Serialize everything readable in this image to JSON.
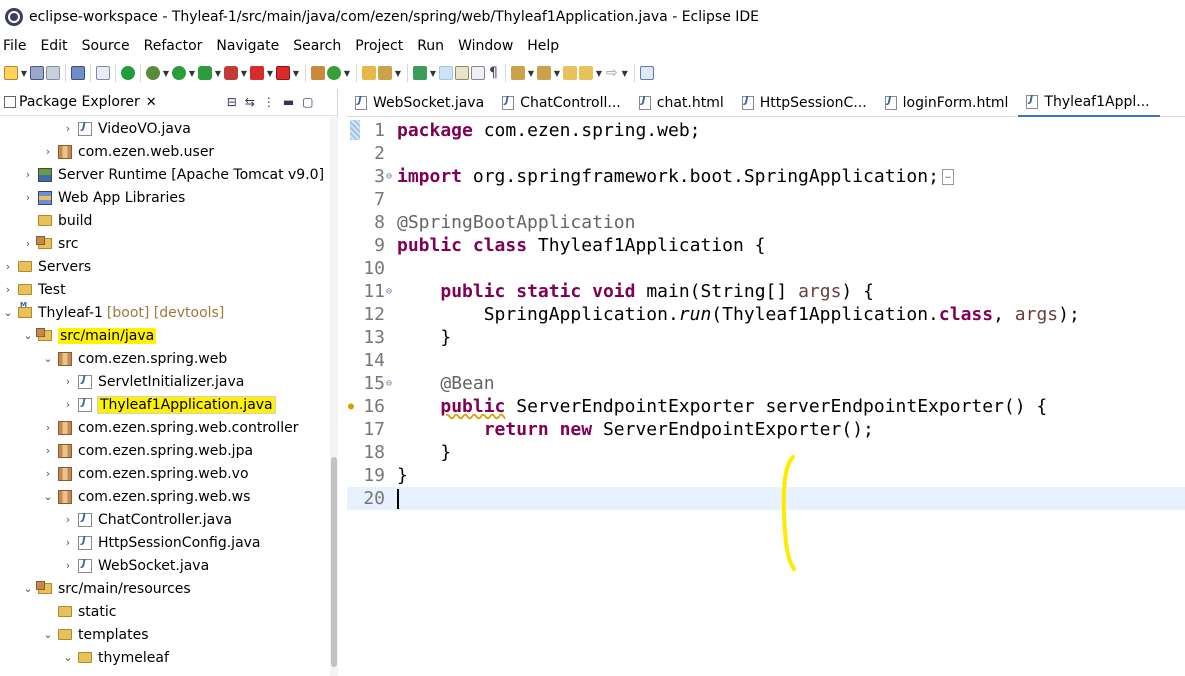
{
  "window": {
    "title": "eclipse-workspace - Thyleaf-1/src/main/java/com/ezen/spring/web/Thyleaf1Application.java - Eclipse IDE"
  },
  "menu": [
    "File",
    "Edit",
    "Source",
    "Refactor",
    "Navigate",
    "Search",
    "Project",
    "Run",
    "Window",
    "Help"
  ],
  "package_explorer": {
    "title": "Package Explorer",
    "close_glyph": "✕",
    "rows": [
      {
        "indent": 3,
        "twisty": "›",
        "icon": "java",
        "label": "VideoVO.java"
      },
      {
        "indent": 2,
        "twisty": "›",
        "icon": "pkg",
        "label": "com.ezen.web.user"
      },
      {
        "indent": 1,
        "twisty": "›",
        "icon": "server",
        "label": "Server Runtime [Apache Tomcat v9.0]"
      },
      {
        "indent": 1,
        "twisty": "›",
        "icon": "lib",
        "label": "Web App Libraries"
      },
      {
        "indent": 1,
        "twisty": "",
        "icon": "folder",
        "label": "build"
      },
      {
        "indent": 1,
        "twisty": "›",
        "icon": "srcfolder",
        "label": "src"
      },
      {
        "indent": 0,
        "twisty": "›",
        "icon": "folder",
        "label": "Servers"
      },
      {
        "indent": 0,
        "twisty": "›",
        "icon": "folder",
        "label": "Test"
      },
      {
        "indent": 0,
        "twisty": "⌄",
        "icon": "project",
        "label": "Thyleaf-1",
        "decoration": "[boot] [devtools]"
      },
      {
        "indent": 1,
        "twisty": "⌄",
        "icon": "srcfolder",
        "label": "src/main/java",
        "highlight": true
      },
      {
        "indent": 2,
        "twisty": "⌄",
        "icon": "pkg",
        "label": "com.ezen.spring.web"
      },
      {
        "indent": 3,
        "twisty": "›",
        "icon": "java",
        "label": "ServletInitializer.java"
      },
      {
        "indent": 3,
        "twisty": "›",
        "icon": "java",
        "label": "Thyleaf1Application.java",
        "highlight": true,
        "selected": true
      },
      {
        "indent": 2,
        "twisty": "›",
        "icon": "pkg",
        "label": "com.ezen.spring.web.controller"
      },
      {
        "indent": 2,
        "twisty": "›",
        "icon": "pkg",
        "label": "com.ezen.spring.web.jpa"
      },
      {
        "indent": 2,
        "twisty": "›",
        "icon": "pkg",
        "label": "com.ezen.spring.web.vo"
      },
      {
        "indent": 2,
        "twisty": "⌄",
        "icon": "pkg",
        "label": "com.ezen.spring.web.ws"
      },
      {
        "indent": 3,
        "twisty": "›",
        "icon": "java",
        "label": "ChatController.java"
      },
      {
        "indent": 3,
        "twisty": "›",
        "icon": "java",
        "label": "HttpSessionConfig.java"
      },
      {
        "indent": 3,
        "twisty": "›",
        "icon": "java",
        "label": "WebSocket.java"
      },
      {
        "indent": 1,
        "twisty": "⌄",
        "icon": "srcfolder",
        "label": "src/main/resources"
      },
      {
        "indent": 2,
        "twisty": "",
        "icon": "folder",
        "label": "static"
      },
      {
        "indent": 2,
        "twisty": "⌄",
        "icon": "folder",
        "label": "templates"
      },
      {
        "indent": 3,
        "twisty": "⌄",
        "icon": "folder",
        "label": "thymeleaf"
      }
    ]
  },
  "editor": {
    "tabs": [
      {
        "label": "WebSocket.java",
        "active": false
      },
      {
        "label": "ChatControll...",
        "active": false
      },
      {
        "label": "chat.html",
        "active": false
      },
      {
        "label": "HttpSessionC...",
        "active": false
      },
      {
        "label": "loginForm.html",
        "active": false
      },
      {
        "label": "Thyleaf1Appl...",
        "active": true
      }
    ],
    "lines": [
      {
        "n": "1",
        "code": "package com.ezen.spring.web;"
      },
      {
        "n": "2",
        "code": ""
      },
      {
        "n": "3",
        "code": "import org.springframework.boot.SpringApplication;",
        "fold": true
      },
      {
        "n": "7",
        "code": ""
      },
      {
        "n": "8",
        "code": "@SpringBootApplication"
      },
      {
        "n": "9",
        "code": "public class Thyleaf1Application {"
      },
      {
        "n": "10",
        "code": ""
      },
      {
        "n": "11",
        "code": "    public static void main(String[] args) {",
        "fold": true
      },
      {
        "n": "12",
        "code": "        SpringApplication.run(Thyleaf1Application.class, args);"
      },
      {
        "n": "13",
        "code": "    }"
      },
      {
        "n": "14",
        "code": ""
      },
      {
        "n": "15",
        "code": "    @Bean",
        "fold": true
      },
      {
        "n": "16",
        "code": "    public ServerEndpointExporter serverEndpointExporter() {",
        "warning": true
      },
      {
        "n": "17",
        "code": "        return new ServerEndpointExporter();"
      },
      {
        "n": "18",
        "code": "    }"
      },
      {
        "n": "19",
        "code": "}"
      },
      {
        "n": "20",
        "code": "",
        "current": true
      }
    ]
  },
  "colors": {
    "keyword": "#7f0055",
    "annotation": "#646464",
    "highlight": "#fff200",
    "current_line": "#e8f2fe"
  }
}
